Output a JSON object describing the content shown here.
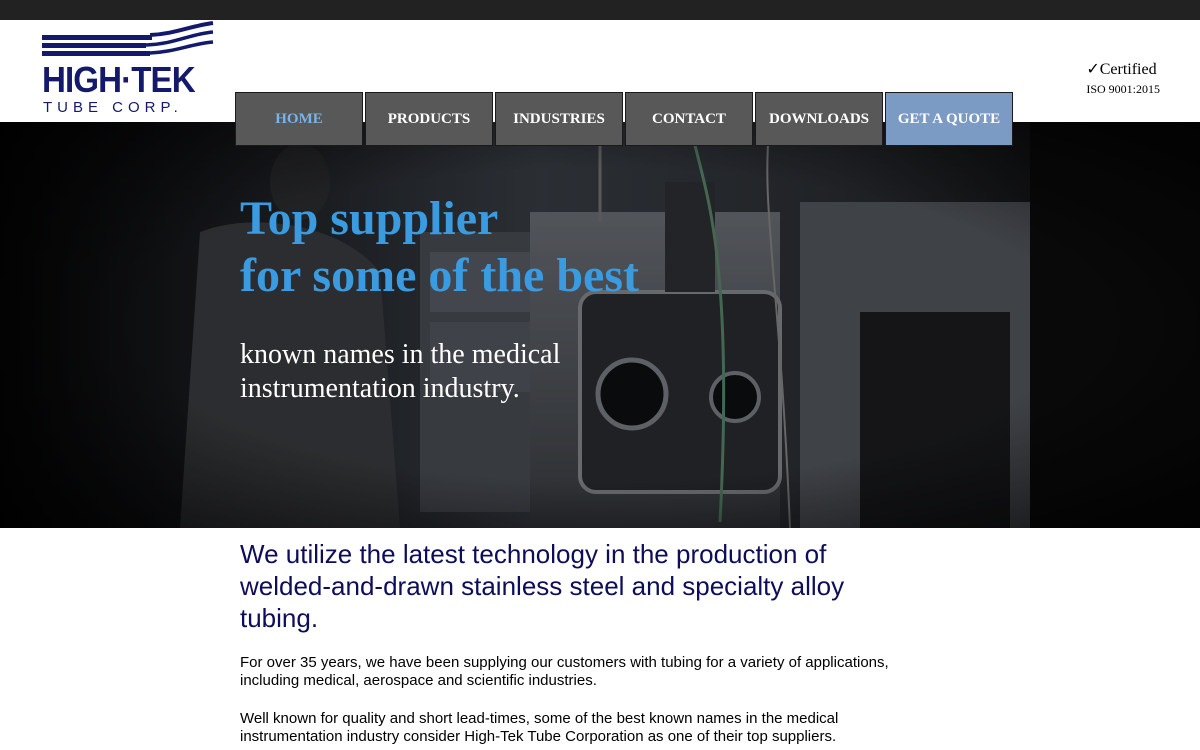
{
  "brand": {
    "logo_main": "HIGH·TEK",
    "logo_sub": "TUBE CORP.",
    "primary_color": "#141a6b"
  },
  "certification": {
    "line1": "✓Certified",
    "line2": "ISO 9001:2015"
  },
  "nav": {
    "items": [
      {
        "label": "HOME",
        "active": true
      },
      {
        "label": "PRODUCTS"
      },
      {
        "label": "INDUSTRIES"
      },
      {
        "label": "CONTACT"
      },
      {
        "label": "DOWNLOADS"
      },
      {
        "label": "GET A QUOTE",
        "highlight": true
      }
    ],
    "item_color": "#585858",
    "active_text_color": "#7ab4e6",
    "quote_color": "#7b9ac4"
  },
  "hero": {
    "title_line1": "Top supplier",
    "title_line2": "for some of the best",
    "subtitle_line1": "known names in the medical",
    "subtitle_line2": "instrumentation industry.",
    "title_color": "#3a9be0"
  },
  "content": {
    "intro": "We utilize the latest technology in the production of welded-and-drawn stainless steel and specialty alloy tubing.",
    "paragraphs": [
      "For over 35 years, we have been supplying our customers with tubing for a variety of applications, including medical, aerospace and scientific industries.",
      "Well known for quality and short lead-times, some of the best known names in the medical instrumentation industry consider High-Tek Tube Corporation as one of their top suppliers."
    ],
    "intro_color": "#0d0d5c"
  }
}
